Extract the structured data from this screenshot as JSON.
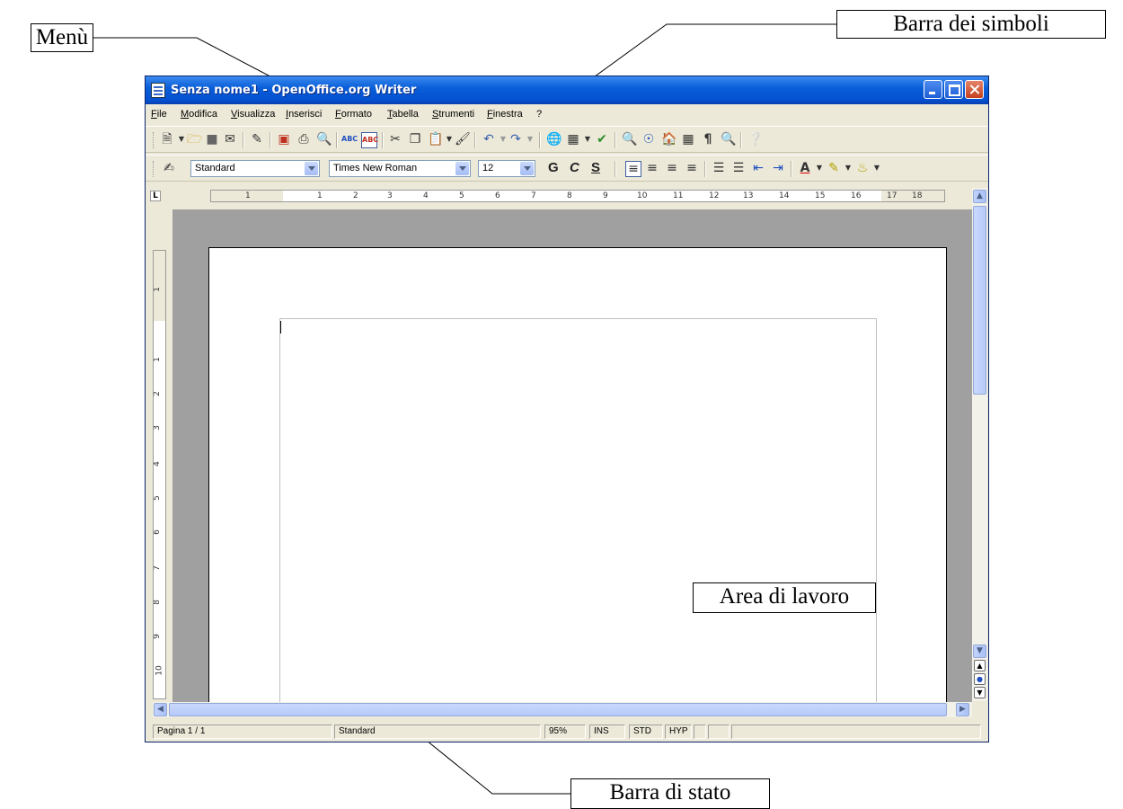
{
  "annotations": {
    "menu": "Menù",
    "toolbar": "Barra dei simboli",
    "workarea": "Area di lavoro",
    "statusbar": "Barra di stato"
  },
  "window": {
    "title": "Senza nome1 - OpenOffice.org Writer"
  },
  "menu": [
    "File",
    "Modifica",
    "Visualizza",
    "Inserisci",
    "Formato",
    "Tabella",
    "Strumenti",
    "Finestra",
    "?"
  ],
  "formatting": {
    "style": "Standard",
    "font": "Times New Roman",
    "size": "12",
    "bold": "G",
    "italic": "C",
    "underline": "S"
  },
  "ruler": {
    "h_labels": [
      "1",
      "1",
      "2",
      "3",
      "4",
      "5",
      "6",
      "7",
      "8",
      "9",
      "10",
      "11",
      "12",
      "13",
      "14",
      "15",
      "16",
      "17",
      "18"
    ],
    "v_labels": [
      "1",
      "1",
      "2",
      "3",
      "4",
      "5",
      "6",
      "7",
      "8",
      "9",
      "10"
    ]
  },
  "status": {
    "page": "Pagina 1 / 1",
    "style": "Standard",
    "zoom": "95%",
    "ins": "INS",
    "std": "STD",
    "hyp": "HYP"
  },
  "icons": [
    "new-icon",
    "open-icon",
    "save-icon",
    "email-icon",
    "edit-icon",
    "pdf-icon",
    "print-icon",
    "preview-icon",
    "spellcheck-icon",
    "autospell-icon",
    "cut-icon",
    "copy-icon",
    "paste-icon",
    "clone-icon",
    "undo-icon",
    "redo-icon",
    "hyperlink-icon",
    "table-icon",
    "draw-icon",
    "find-icon",
    "navigator-icon",
    "gallery-icon",
    "datasource-icon",
    "pilcrow-icon",
    "zoom-icon",
    "help-icon"
  ]
}
